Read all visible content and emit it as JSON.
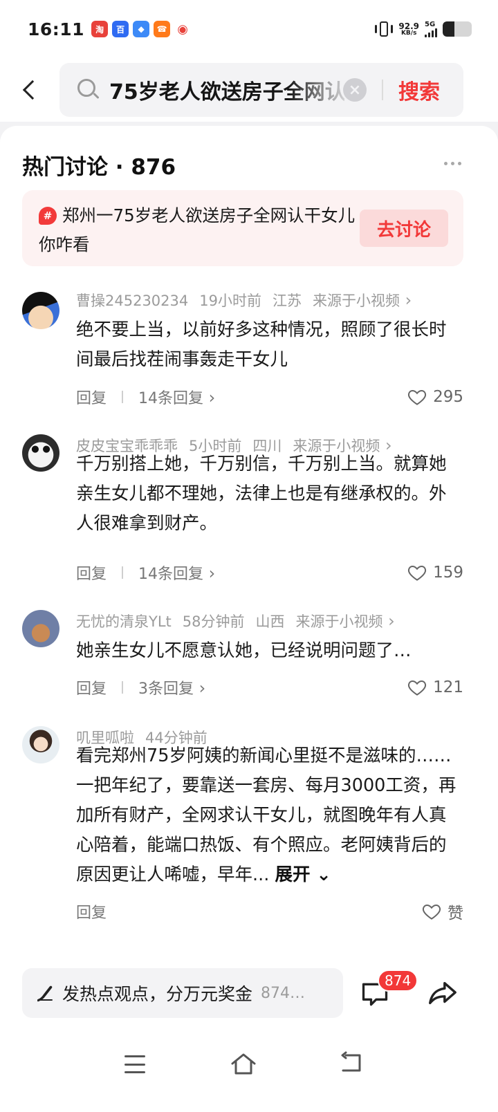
{
  "status_bar": {
    "time": "16:11",
    "net_speed_value": "92.9",
    "net_speed_unit": "KB/s",
    "network": "5G",
    "battery_level": 0.4
  },
  "search": {
    "query": "75岁老人欲送房子全网认",
    "button_label": "搜索"
  },
  "section": {
    "title": "热门讨论 · 876"
  },
  "topic": {
    "hash_symbol": "#",
    "text": "郑州一75岁老人欲送房子全网认干女儿你咋看",
    "button_label": "去讨论"
  },
  "comments": [
    {
      "author": "曹操245230234",
      "time": "19小时前",
      "location": "江苏",
      "source": "来源于小视频",
      "text": "绝不要上当，以前好多这种情况，照顾了很长时间最后找茬闹事轰走干女儿",
      "reply_label": "回复",
      "replies": "14条回复",
      "likes": "295"
    },
    {
      "author": "皮皮宝宝乖乖乖",
      "time": "5小时前",
      "location": "四川",
      "source": "来源于小视频",
      "text": "千万别搭上她，千万别信，千万别上当。就算她亲生女儿都不理她，法律上也是有继承权的。外人很难拿到财产。",
      "reply_label": "回复",
      "replies": "14条回复",
      "likes": "159"
    },
    {
      "author": "无忧的清泉YLt",
      "time": "58分钟前",
      "location": "山西",
      "source": "来源于小视频",
      "text": "她亲生女儿不愿意认她，已经说明问题了…",
      "reply_label": "回复",
      "replies": "3条回复",
      "likes": "121"
    },
    {
      "author": "叽里呱啦",
      "time": "44分钟前",
      "text": "看完郑州75岁阿姨的新闻心里挺不是滋味的……一把年纪了，要靠送一套房、每月3000工资，再加所有财产，全网求认干女儿，就图晚年有人真心陪着，能端口热饭、有个照应。老阿姨背后的原因更让人唏嘘，早年...",
      "expand_label": "展开",
      "reply_label": "回复",
      "likes": "赞"
    }
  ],
  "bottom_bar": {
    "post_placeholder": "发热点观点，分万元奖金",
    "post_count": "874…",
    "comment_badge": "874"
  },
  "colors": {
    "accent": "#f23838",
    "banner_bg": "#fdf2f2",
    "meta_text": "#9b9b9b"
  },
  "icons": [
    "back-icon",
    "search-icon",
    "clear-icon",
    "more-icon",
    "hashtag-icon",
    "heart-icon",
    "pen-icon",
    "comment-icon",
    "share-icon",
    "menu-icon",
    "home-icon",
    "nav-back-icon"
  ]
}
